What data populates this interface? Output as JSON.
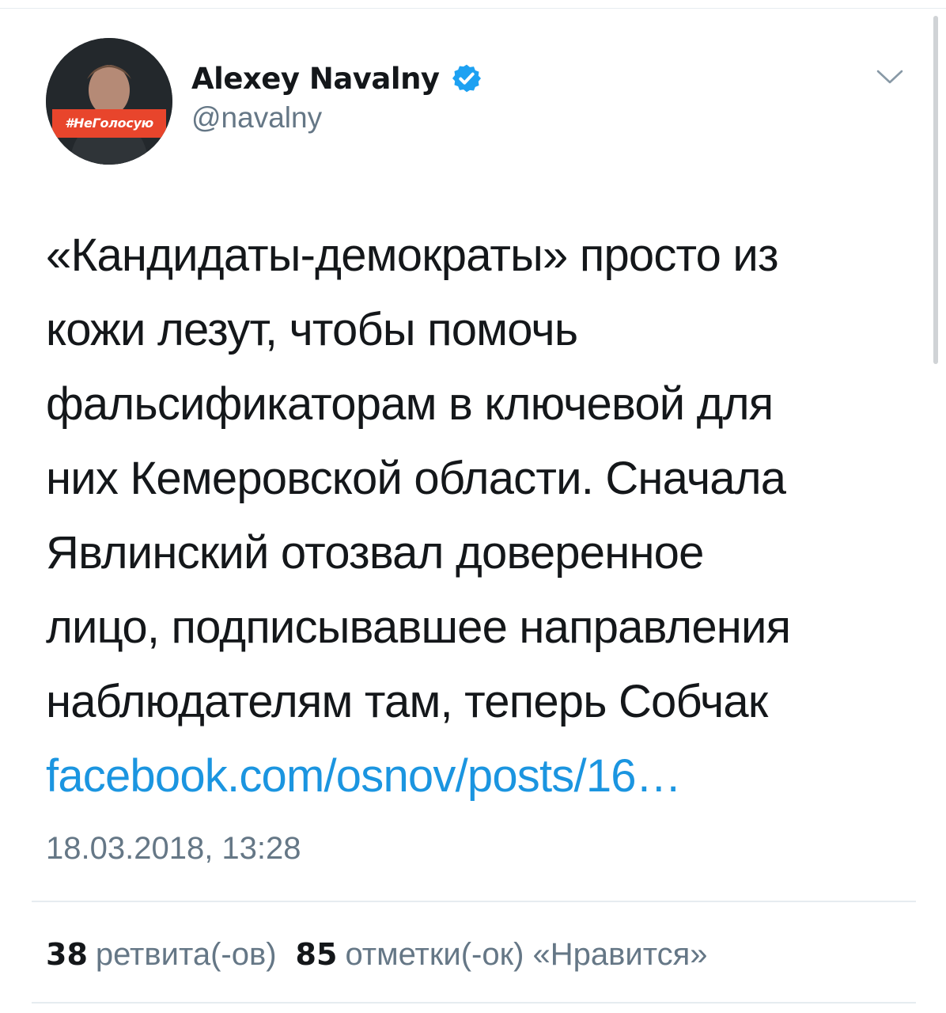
{
  "tweet": {
    "author": {
      "display_name": "Alexey Navalny",
      "handle": "@navalny",
      "avatar_tag": "#НеГолосую",
      "verified": true
    },
    "text_lines": [
      "«Кандидаты-демократы» просто из",
      "кожи лезут, чтобы помочь",
      "фальсификаторам в ключевой для",
      "них Кемеровской области. Сначала",
      "Явлинский отозвал доверенное",
      "лицо, подписывавшее направления",
      "наблюдателям там, теперь Собчак"
    ],
    "link": "facebook.com/osnov/posts/16…",
    "timestamp": "18.03.2018, 13:28",
    "stats": {
      "retweets_count": "38",
      "retweets_label": "ретвита(-ов)",
      "likes_count": "85",
      "likes_label": "отметки(-ок) «Нравится»"
    }
  },
  "colors": {
    "text": "#14171a",
    "secondary": "#657786",
    "link": "#1b95e0",
    "verified": "#1da1f2",
    "divider": "#e6ecf0",
    "avatar_tag_bg": "#e8452c"
  },
  "icons": {
    "verified": "verified-badge-icon",
    "more": "chevron-down-icon"
  }
}
